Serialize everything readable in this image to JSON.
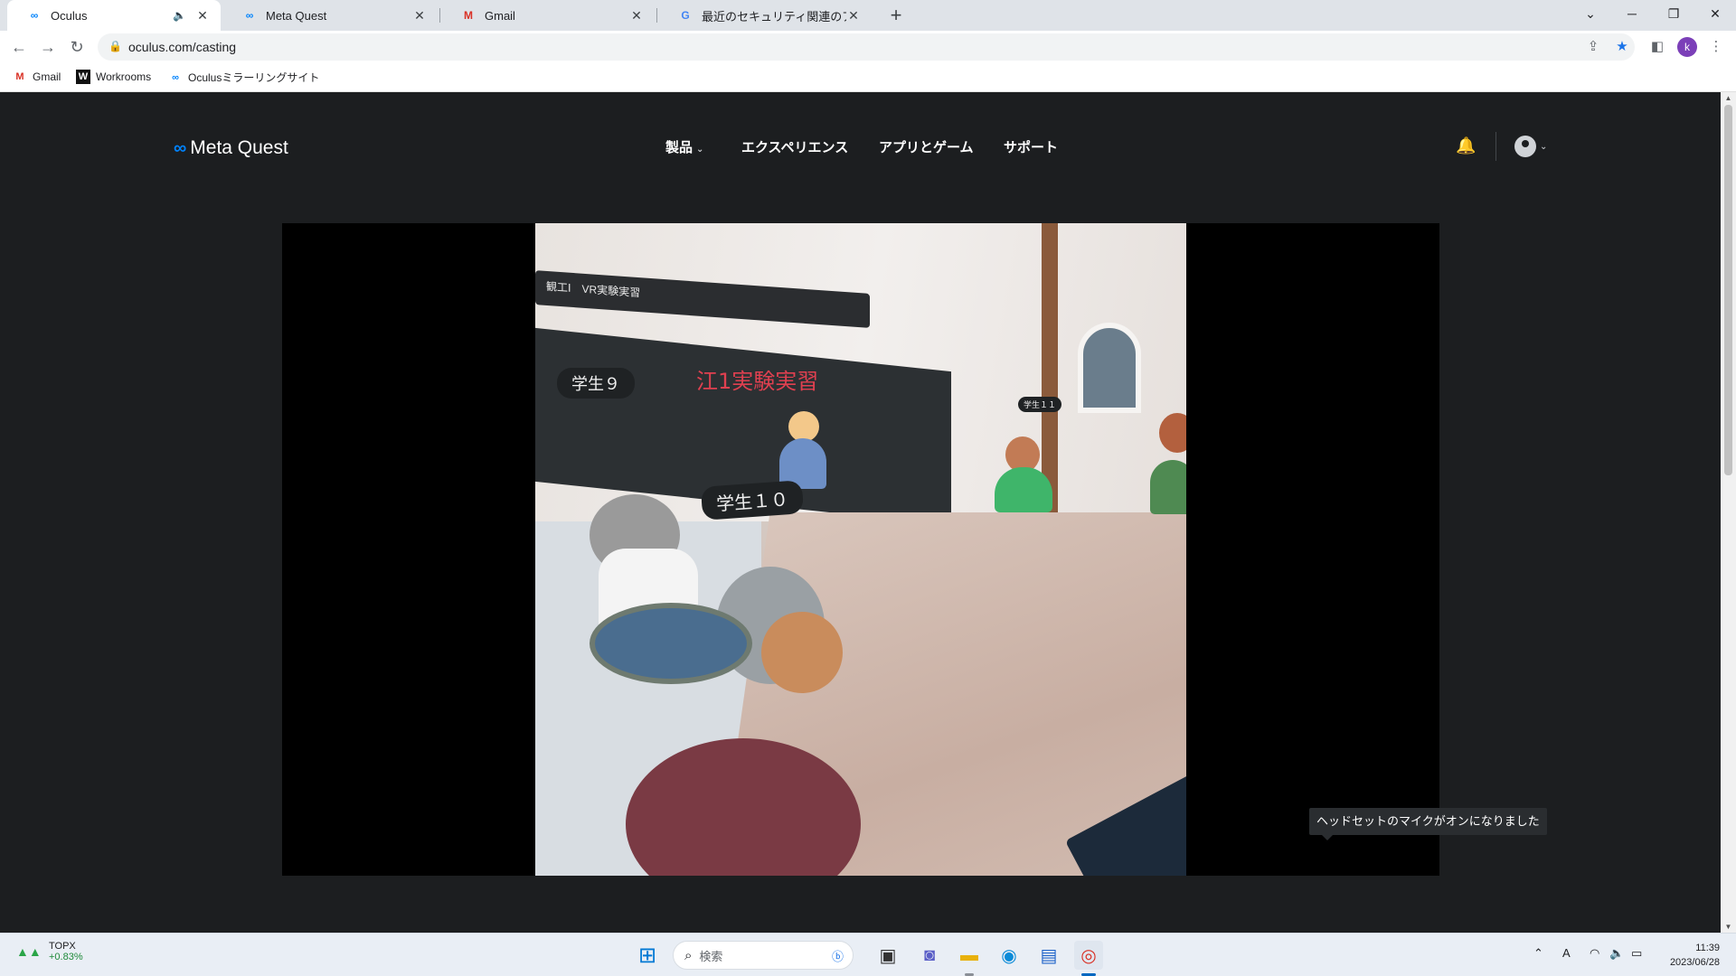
{
  "browser": {
    "tabs": [
      {
        "title": "Oculus",
        "active": true,
        "audio": true
      },
      {
        "title": "Meta Quest",
        "active": false
      },
      {
        "title": "Gmail",
        "active": false
      },
      {
        "title": "最近のセキュリティ関連のアクティビテ",
        "active": false
      }
    ],
    "url": "oculus.com/casting",
    "profile_initial": "k",
    "bookmarks": [
      "Gmail",
      "Workrooms",
      "Oculusミラーリングサイト"
    ]
  },
  "site": {
    "brand": "Meta Quest",
    "nav": [
      {
        "label": "製品",
        "has_dropdown": true
      },
      {
        "label": "エクスペリエンス"
      },
      {
        "label": "アプリとゲーム"
      },
      {
        "label": "サポート"
      }
    ]
  },
  "cast_view": {
    "sign_text": "観工Ⅰ　VR実験実習",
    "board_title": "江1実験実習",
    "labels": [
      "学生９",
      "学生１０",
      "学生１１"
    ]
  },
  "toast": "ヘッドセットのマイクがオンになりました",
  "taskbar": {
    "widget_name": "TOPX",
    "widget_change": "+0.83%",
    "search_placeholder": "検索",
    "time": "11:39",
    "date": "2023/06/28"
  },
  "colors": {
    "page_bg": "#1c1e20",
    "brand_blue": "#0082fb",
    "board_text": "#e04050"
  }
}
